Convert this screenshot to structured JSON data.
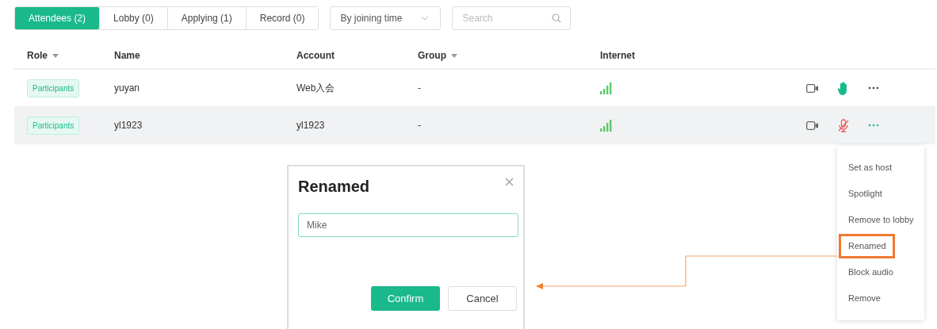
{
  "tabs": [
    {
      "label": "Attendees (2)",
      "selected": true
    },
    {
      "label": "Lobby (0)",
      "selected": false
    },
    {
      "label": "Applying (1)",
      "selected": false
    },
    {
      "label": "Record (0)",
      "selected": false
    }
  ],
  "sort_dropdown": {
    "value": "By joining time"
  },
  "search": {
    "placeholder": "Search"
  },
  "table": {
    "columns": [
      {
        "label": "Role",
        "sortable": true
      },
      {
        "label": "Name",
        "sortable": false
      },
      {
        "label": "Account",
        "sortable": false
      },
      {
        "label": "Group",
        "sortable": true
      },
      {
        "label": "Internet",
        "sortable": false
      }
    ],
    "rows": [
      {
        "role": "Participants",
        "name": "yuyan",
        "account": "Web入会",
        "group": "-",
        "selected": false,
        "hand_raised": true,
        "audio_muted": false
      },
      {
        "role": "Participants",
        "name": "yl1923",
        "account": "yl1923",
        "group": "-",
        "selected": true,
        "hand_raised": false,
        "audio_muted": true
      }
    ]
  },
  "menu": {
    "items": [
      {
        "label": "Set as host",
        "selected": false
      },
      {
        "label": "Spotlight",
        "selected": false
      },
      {
        "label": "Remove to lobby",
        "selected": false
      },
      {
        "label": "Renamed",
        "selected": true
      },
      {
        "label": "Block audio",
        "selected": false
      },
      {
        "label": "Remove",
        "selected": false
      }
    ]
  },
  "dialog": {
    "title": "Renamed",
    "value": "Mike",
    "buttons": [
      {
        "label": "Confirm",
        "kind": "primary"
      },
      {
        "label": "Cancel",
        "kind": "default"
      }
    ]
  }
}
